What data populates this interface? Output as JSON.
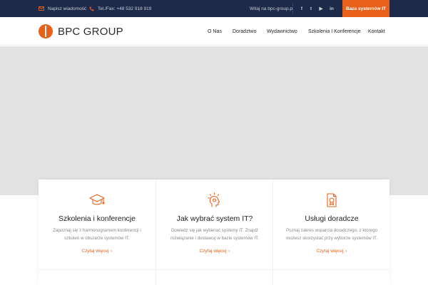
{
  "topbar": {
    "email_label": "Napisz wiadomość",
    "phone_label": "Tel./Fax: +48 532 918 919",
    "welcome": "Witaj na bpc-group.pl",
    "social": [
      {
        "icon": "facebook-icon",
        "glyph": "f"
      },
      {
        "icon": "twitter-icon",
        "glyph": "t"
      },
      {
        "icon": "youtube-icon",
        "glyph": "▶"
      },
      {
        "icon": "linkedin-icon",
        "glyph": "in"
      }
    ],
    "cta_label": "Baza systemów IT"
  },
  "brand": {
    "name": "BPC GROUP",
    "accent": "#e8611a",
    "dark": "#1e2a4a"
  },
  "nav": [
    "O Nas",
    "Doradztwo",
    "Wydawnictwo",
    "Szkolenia I Konferencje",
    "Kontakt"
  ],
  "cards": [
    {
      "icon": "graduation-cap-icon",
      "title": "Szkolenia i konferencje",
      "text_line1": "Zapoznaj się z harmonogramem konferencji i",
      "text_line2": "szkoleń w obszarze systemów IT.",
      "link": "Czytaj więcej"
    },
    {
      "icon": "head-idea-icon",
      "title": "Jak wybrać system IT?",
      "text_line1": "Dowiedz się jak wybierać systemy IT. Znajdź",
      "text_line2": "rozwiązanie i dostawcę w bazie systemów IT.",
      "link": "Czytaj więcej"
    },
    {
      "icon": "document-badge-icon",
      "title": "Usługi doradcze",
      "text_line1": "Poznaj zakres wsparcia doradczego, z którego",
      "text_line2": "możesz skorzystać przy wyborze systemów IT.",
      "link": "Czytaj więcej"
    }
  ]
}
